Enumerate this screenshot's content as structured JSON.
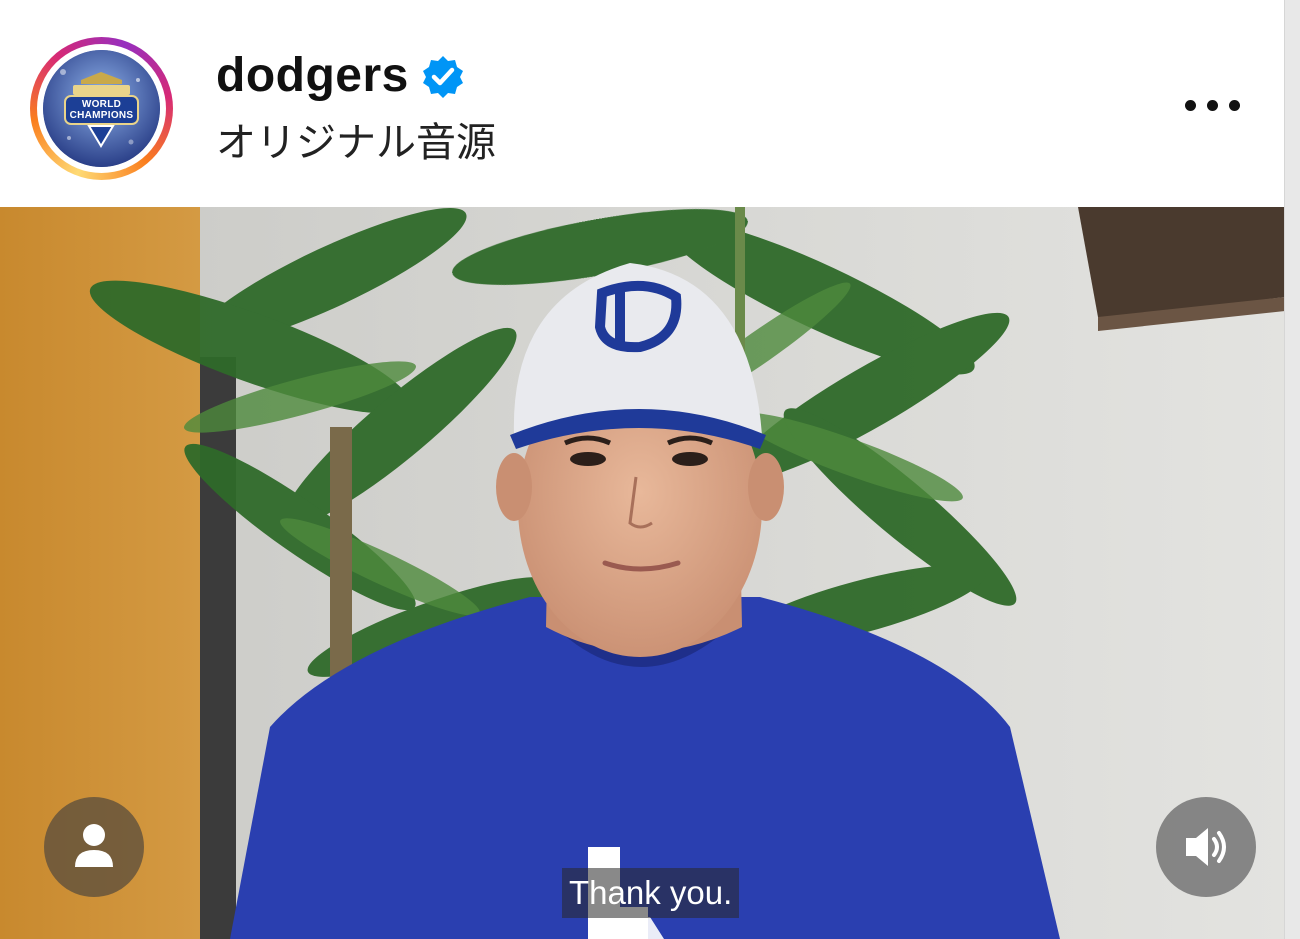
{
  "post_header": {
    "username": "dodgers",
    "verified": true,
    "audio_label": "オリジナル音源",
    "avatar": {
      "icon": "world-champions-logo",
      "text": "WORLD CHAMPIONS"
    },
    "more_icon": "more-options-icon"
  },
  "video": {
    "caption": "Thank you.",
    "controls": {
      "tags_icon": "user-icon",
      "audio_icon": "speaker-on-icon"
    }
  },
  "colors": {
    "verified_blue": "#0095f6",
    "ring_gradient": [
      "#feda75",
      "#fa7e1e",
      "#d62976",
      "#962fbf"
    ],
    "shirt_blue": "#2a3fb0"
  }
}
